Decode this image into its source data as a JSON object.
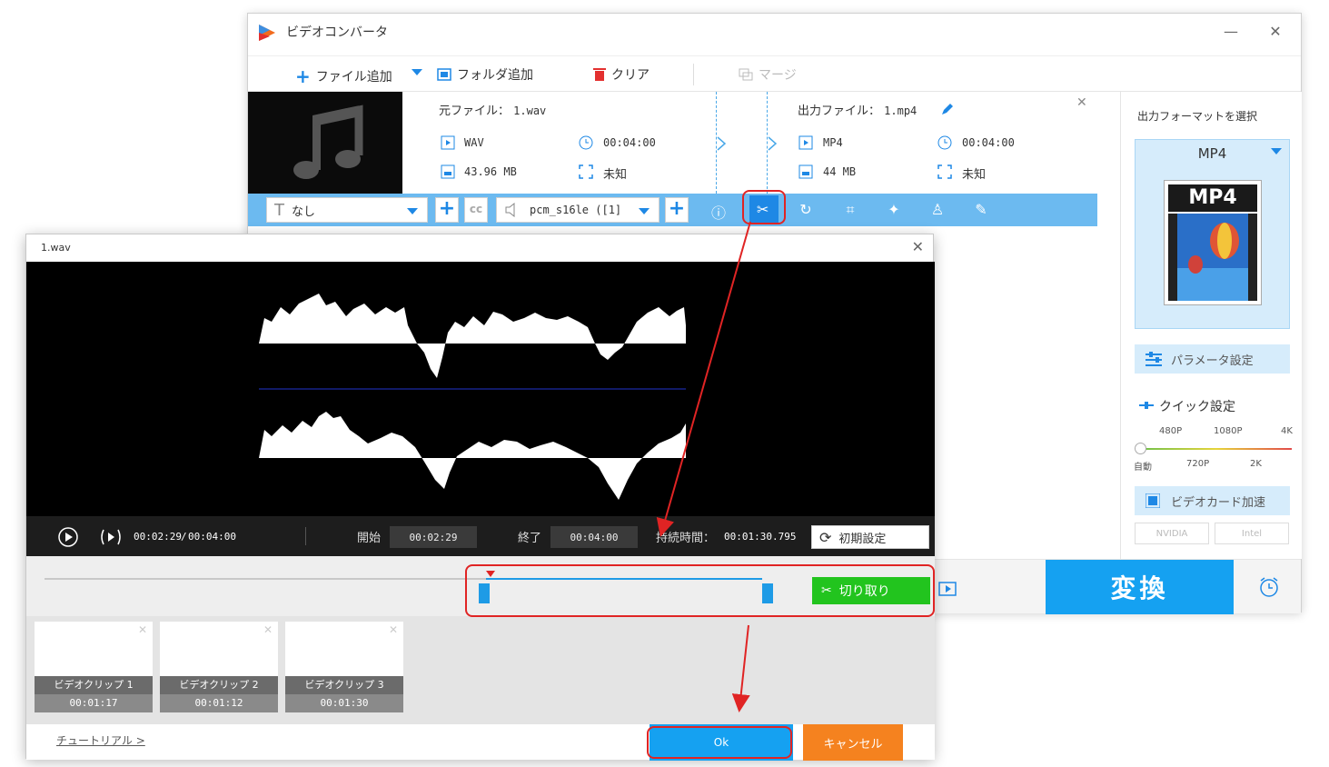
{
  "app": {
    "title": "ビデオコンバータ",
    "minimize": "—",
    "close": "✕"
  },
  "toolbar": {
    "add_file": "ファイル追加",
    "add_folder": "フォルダ追加",
    "clear": "クリア",
    "merge": "マージ"
  },
  "source": {
    "label": "元ファイル：",
    "filename": "1.wav",
    "format": "WAV",
    "duration": "00:04:00",
    "size": "43.96 MB",
    "resolution": "未知"
  },
  "output": {
    "label": "出力ファイル：",
    "filename": "1.mp4",
    "format": "MP4",
    "duration": "00:04:00",
    "size": "44 MB",
    "resolution": "未知"
  },
  "edit_bar": {
    "subtitle_value": "なし",
    "audio_value": "pcm_s16le ([1]"
  },
  "right_panel": {
    "heading": "出力フォーマットを選択",
    "format_name": "MP4",
    "format_badge": "MP4",
    "param_settings": "パラメータ設定",
    "quick_settings": "クイック設定",
    "quality_top": [
      "480P",
      "1080P",
      "4K"
    ],
    "quality_bottom": [
      "自動",
      "720P",
      "2K"
    ],
    "gpu_accel": "ビデオカード加速",
    "gpu_vendors": [
      "NVIDIA",
      "Intel"
    ]
  },
  "convert_button": "変換",
  "dialog": {
    "title": "1.wav",
    "close": "✕",
    "current_time": "00:02:29",
    "separator": "/",
    "total_time": "00:04:00",
    "start_label": "開始",
    "start_value": "00:02:29",
    "end_label": "終了",
    "end_value": "00:04:00",
    "duration_label": "持続時間：",
    "duration_value": "00:01:30.795",
    "reset": "初期設定",
    "cut_button": "切り取り",
    "clips": [
      {
        "name": "ビデオクリップ 1",
        "duration": "00:01:17"
      },
      {
        "name": "ビデオクリップ 2",
        "duration": "00:01:12"
      },
      {
        "name": "ビデオクリップ 3",
        "duration": "00:01:30"
      }
    ],
    "tutorial": "チュートリアル >",
    "ok": "Ok",
    "cancel": "キャンセル"
  },
  "colors": {
    "accent_blue": "#15a1f1",
    "bar_blue": "#6cbaf0",
    "cut_green": "#22c41e",
    "cancel_orange": "#f5821f",
    "highlight_red": "#e02424"
  }
}
